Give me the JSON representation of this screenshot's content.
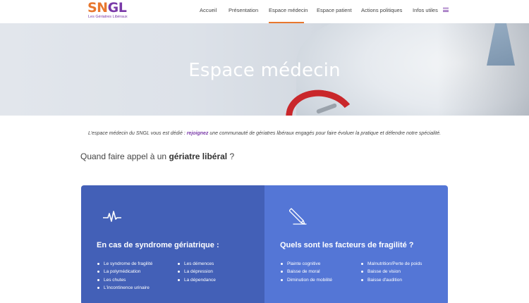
{
  "logo": {
    "sn": "SN",
    "gl": "GL",
    "subtitle": "Les Gériatres Libéraux"
  },
  "nav": {
    "items": [
      "Accueil",
      "Présentation",
      "Espace médecin",
      "Espace patient",
      "Actions politiques",
      "Infos utiles"
    ],
    "active_index": 2,
    "language_icon": "flag-icon"
  },
  "hero": {
    "title": "Espace médecin"
  },
  "intro": {
    "before": "L'espace médecin du SNGL vous est dédié : ",
    "link": "rejoignez",
    "after": " une communauté de gériatres libéraux engagés pour faire évoluer la pratique et défendre notre spécialité."
  },
  "question": {
    "before": "Quand faire appel à un ",
    "bold": "gériatre libéral",
    "after": " ?"
  },
  "cards": [
    {
      "icon": "heartbeat-icon",
      "title": "En cas de syndrome gériatrique :",
      "col1": [
        "Le syndrome de fragilité",
        "La polymédication",
        "Les chutes",
        "L'incontinence urinaire"
      ],
      "col2": [
        "Les démences",
        "La dépression",
        "La dépendance"
      ]
    },
    {
      "icon": "pen-icon",
      "title": "Quels sont les facteurs de fragilité ?",
      "col1": [
        "Plainte cognitive",
        "Baisse de moral",
        "Diminution de mobilité"
      ],
      "col2": [
        "Malnutrition/Perte de poids",
        "Baisse de vision",
        "Baisse d'audition"
      ]
    }
  ],
  "colors": {
    "accent_orange": "#e8772e",
    "brand_purple": "#7a3aa8",
    "card_left": "#4360b7",
    "card_right": "#5476d6"
  }
}
